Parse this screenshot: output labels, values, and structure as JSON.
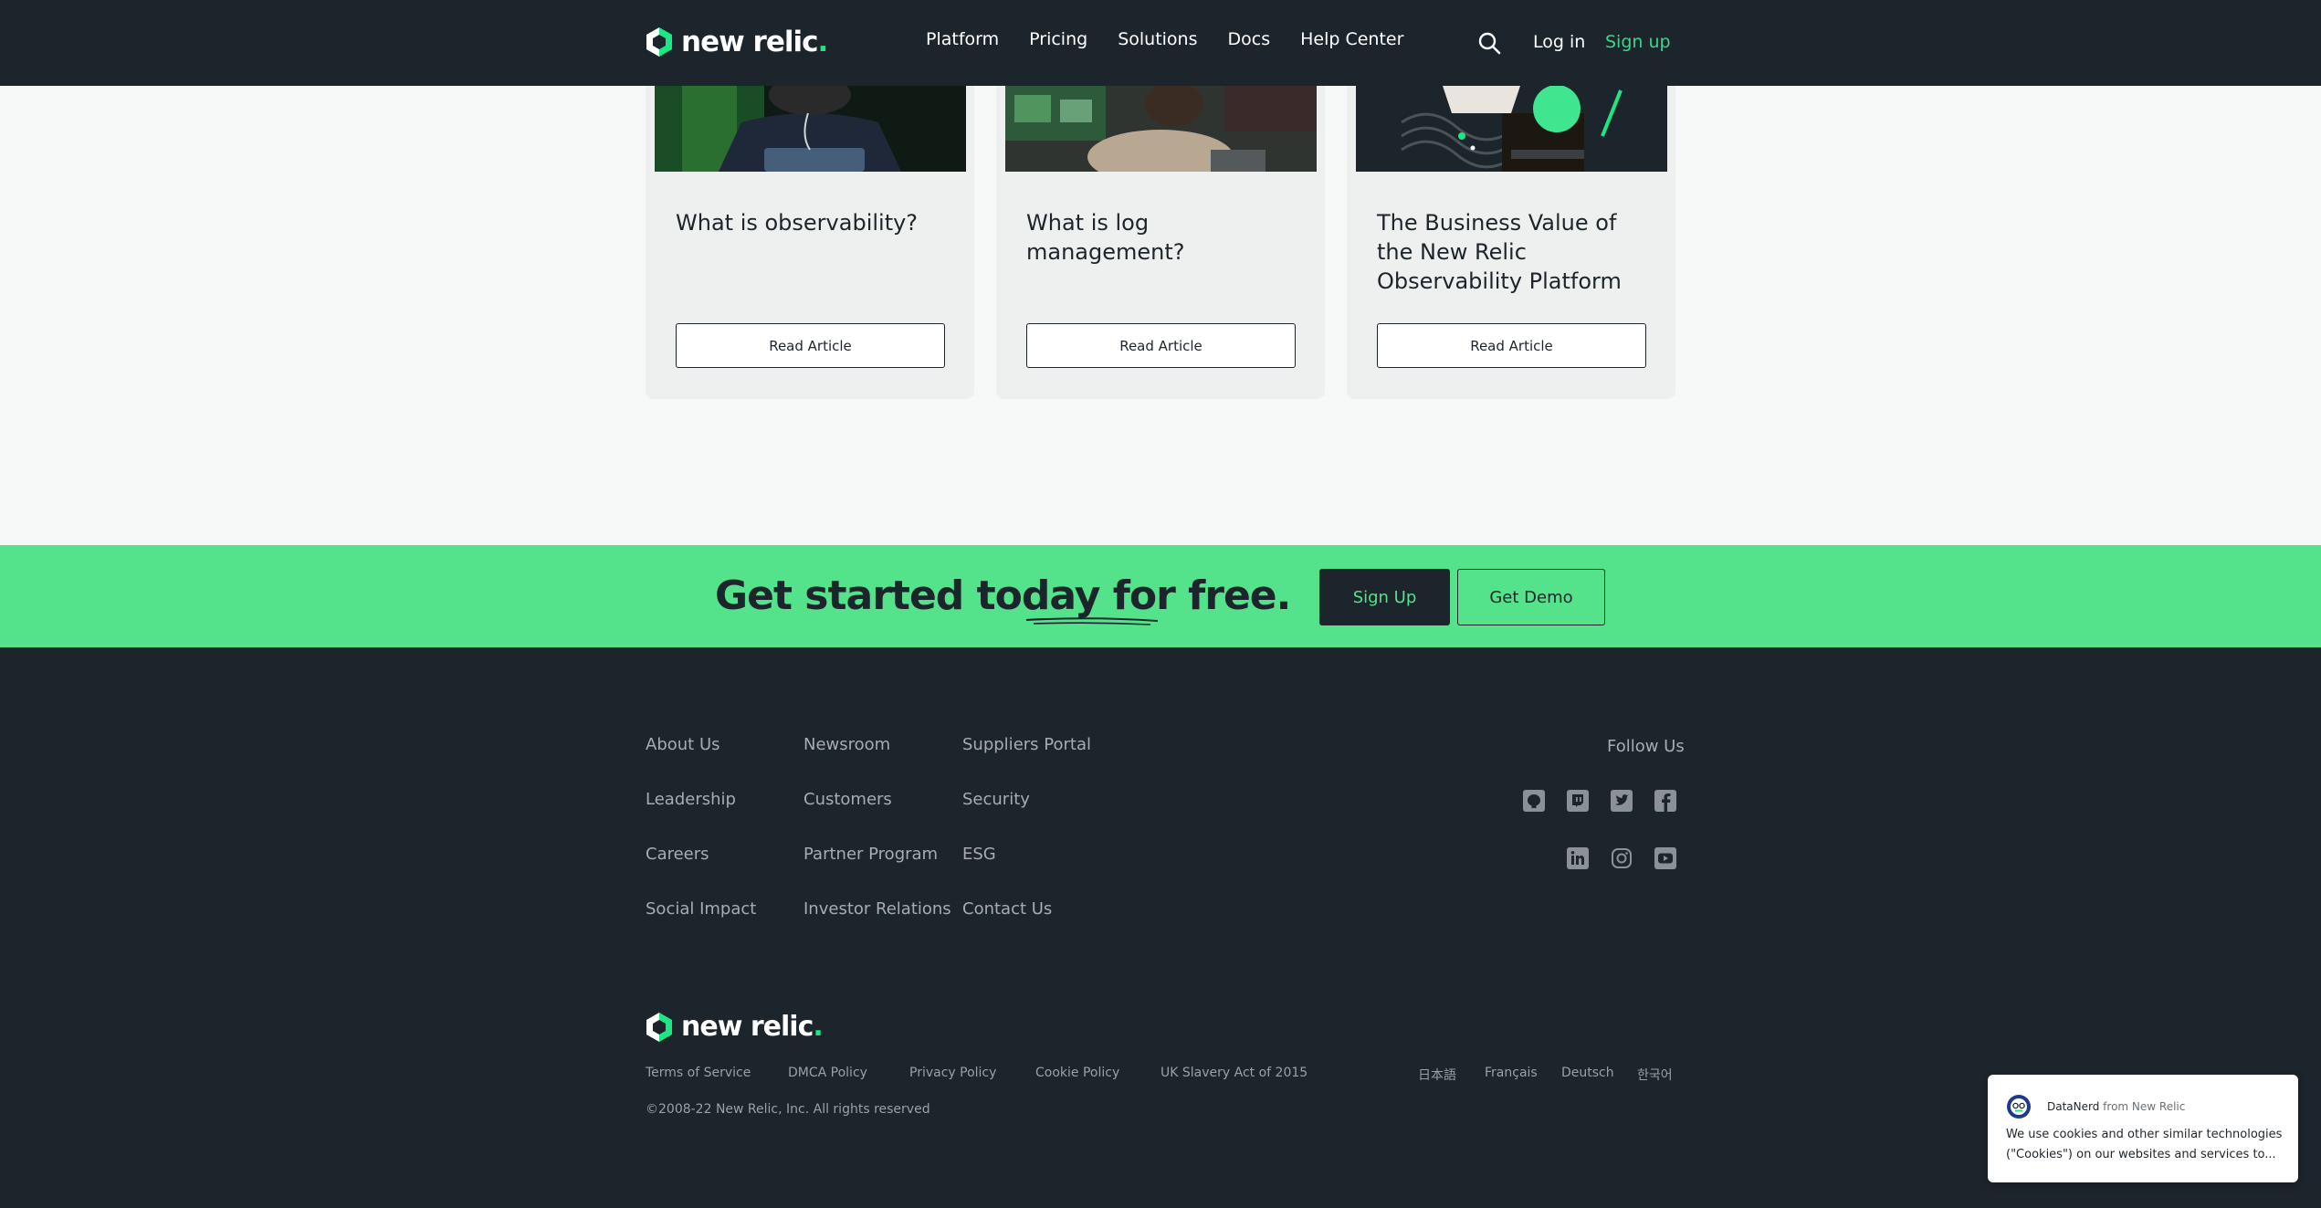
{
  "brand": {
    "name": "new relic",
    "dot": ".",
    "accent": "#1ce783",
    "cta_green": "#54e28a",
    "dark": "#1d252c"
  },
  "header": {
    "nav": [
      "Platform",
      "Pricing",
      "Solutions",
      "Docs",
      "Help Center"
    ],
    "login": "Log in",
    "signup": "Sign up",
    "search_icon": "search-icon"
  },
  "cards": [
    {
      "title": "What is observability?",
      "button": "Read Article"
    },
    {
      "title": "What is log management?",
      "button": "Read Article"
    },
    {
      "title": "The Business Value of the New Relic Observability Platform",
      "button": "Read Article"
    }
  ],
  "cta": {
    "heading_start": "Get started today ",
    "heading_emph": "for free.",
    "signup": "Sign Up",
    "demo": "Get Demo"
  },
  "footer": {
    "col1": [
      "About Us",
      "Leadership",
      "Careers",
      "Social Impact"
    ],
    "col2": [
      "Newsroom",
      "Customers",
      "Partner Program",
      "Investor Relations"
    ],
    "col3": [
      "Suppliers Portal",
      "Security",
      "ESG",
      "Contact Us"
    ],
    "follow": "Follow Us",
    "social_icons": [
      "github-icon",
      "twitch-icon",
      "twitter-icon",
      "facebook-icon",
      "linkedin-icon",
      "instagram-icon",
      "youtube-icon"
    ],
    "legal": [
      "Terms of Service",
      "DMCA Policy",
      "Privacy Policy",
      "Cookie Policy",
      "UK Slavery Act of 2015"
    ],
    "languages": [
      "日本語",
      "Français",
      "Deutsch",
      "한국어"
    ],
    "copyright": "©2008-22 New Relic, Inc. All rights reserved"
  },
  "cookie": {
    "name": "DataNerd",
    "from": " from New Relic",
    "message": "We use cookies and other similar technologies (\"Cookies\") on our websites and services to..."
  }
}
